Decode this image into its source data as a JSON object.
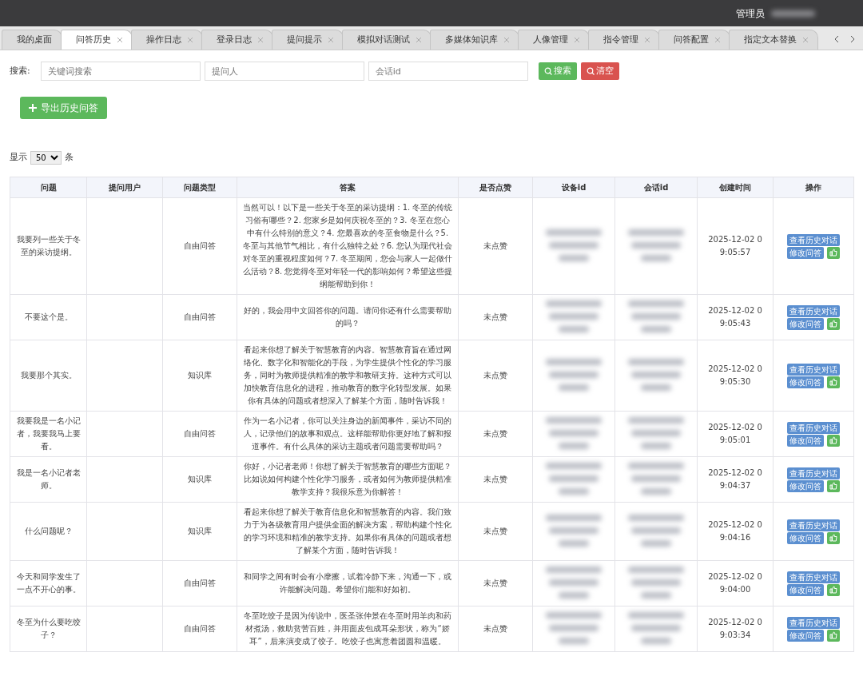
{
  "header": {
    "user_label": "管理员"
  },
  "tabs": [
    {
      "label": "我的桌面",
      "selected": false,
      "closable": false
    },
    {
      "label": "问答历史",
      "selected": true,
      "closable": true
    },
    {
      "label": "操作日志",
      "selected": false,
      "closable": true
    },
    {
      "label": "登录日志",
      "selected": false,
      "closable": true
    },
    {
      "label": "提问提示",
      "selected": false,
      "closable": true
    },
    {
      "label": "模拟对话测试",
      "selected": false,
      "closable": true
    },
    {
      "label": "多媒体知识库",
      "selected": false,
      "closable": true
    },
    {
      "label": "人像管理",
      "selected": false,
      "closable": true
    },
    {
      "label": "指令管理",
      "selected": false,
      "closable": true
    },
    {
      "label": "问答配置",
      "selected": false,
      "closable": true
    },
    {
      "label": "指定文本替换",
      "selected": false,
      "closable": true
    }
  ],
  "search": {
    "label": "搜索:",
    "fields": [
      {
        "placeholder": "关键词搜索"
      },
      {
        "placeholder": "提问人"
      },
      {
        "placeholder": "会话id"
      }
    ],
    "search_button": "搜索",
    "clear_button": "清空"
  },
  "export_button": "导出历史问答",
  "page_size": {
    "prefix": "显示",
    "value": "50",
    "suffix": "条"
  },
  "table": {
    "columns": [
      "问题",
      "提问用户",
      "问题类型",
      "答案",
      "是否点赞",
      "设备id",
      "会话id",
      "创建时间",
      "操作"
    ],
    "rows": [
      {
        "question": "我要列一些关于冬至的采访提纲。",
        "type": "自由问答",
        "answer": "当然可以！以下是一些关于冬至的采访提纲：1. 冬至的传统习俗有哪些？2. 您家乡是如何庆祝冬至的？3. 冬至在您心中有什么特别的意义？4. 您最喜欢的冬至食物是什么？5. 冬至与其他节气相比，有什么独特之处？6. 您认为现代社会对冬至的重视程度如何？7. 冬至期间，您会与家人一起做什么活动？8. 您觉得冬至对年轻一代的影响如何？希望这些提纲能帮助到你！",
        "liked": "未点赞",
        "created": "2025-12-02 09:05:57",
        "actions": [
          "查看历史对话",
          "修改问答"
        ]
      },
      {
        "question": "不要这个是。",
        "type": "自由问答",
        "answer": "好的，我会用中文回答你的问题。请问你还有什么需要帮助的吗？",
        "liked": "未点赞",
        "created": "2025-12-02 09:05:43",
        "actions": [
          "查看历史对话",
          "修改问答"
        ]
      },
      {
        "question": "我要那个其实。",
        "type": "知识库",
        "answer": "看起来你想了解关于智慧教育的内容。智慧教育旨在通过网络化、数字化和智能化的手段，为学生提供个性化的学习服务，同时为教师提供精准的教学和教研支持。这种方式可以加快教育信息化的进程，推动教育的数字化转型发展。如果你有具体的问题或者想深入了解某个方面，随时告诉我！",
        "liked": "未点赞",
        "created": "2025-12-02 09:05:30",
        "actions": [
          "查看历史对话",
          "修改问答"
        ]
      },
      {
        "question": "我要我是一名小记者，我要我马上要看。",
        "type": "自由问答",
        "answer": "作为一名小记者，你可以关注身边的新闻事件，采访不同的人，记录他们的故事和观点。这样能帮助你更好地了解和报道事件。有什么具体的采访主题或者问题需要帮助吗？",
        "liked": "未点赞",
        "created": "2025-12-02 09:05:01",
        "actions": [
          "查看历史对话",
          "修改问答"
        ]
      },
      {
        "question": "我是一名小记者老师。",
        "type": "知识库",
        "answer": "你好，小记者老师！你想了解关于智慧教育的哪些方面呢？比如说如何构建个性化学习服务，或者如何为教师提供精准教学支持？我很乐意为你解答！",
        "liked": "未点赞",
        "created": "2025-12-02 09:04:37",
        "actions": [
          "查看历史对话",
          "修改问答"
        ]
      },
      {
        "question": "什么问题呢？",
        "type": "知识库",
        "answer": "看起来你想了解关于教育信息化和智慧教育的内容。我们致力于为各级教育用户提供全面的解决方案，帮助构建个性化的学习环境和精准的教学支持。如果你有具体的问题或者想了解某个方面，随时告诉我！",
        "liked": "未点赞",
        "created": "2025-12-02 09:04:16",
        "actions": [
          "查看历史对话",
          "修改问答"
        ]
      },
      {
        "question": "今天和同学发生了一点不开心的事。",
        "type": "自由问答",
        "answer": "和同学之间有时会有小摩擦，试着冷静下来，沟通一下，或许能解决问题。希望你们能和好如初。",
        "liked": "未点赞",
        "created": "2025-12-02 09:04:00",
        "actions": [
          "查看历史对话",
          "修改问答"
        ]
      },
      {
        "question": "冬至为什么要吃饺子？",
        "type": "自由问答",
        "answer": "冬至吃饺子是因为传说中，医圣张仲景在冬至时用羊肉和药材煮汤，救助贫苦百姓，并用面皮包成耳朵形状，称为“娇耳”，后来演变成了饺子。吃饺子也寓意着团圆和温暖。",
        "liked": "未点赞",
        "created": "2025-12-02 09:03:34",
        "actions": [
          "查看历史对话",
          "修改问答"
        ]
      }
    ]
  }
}
